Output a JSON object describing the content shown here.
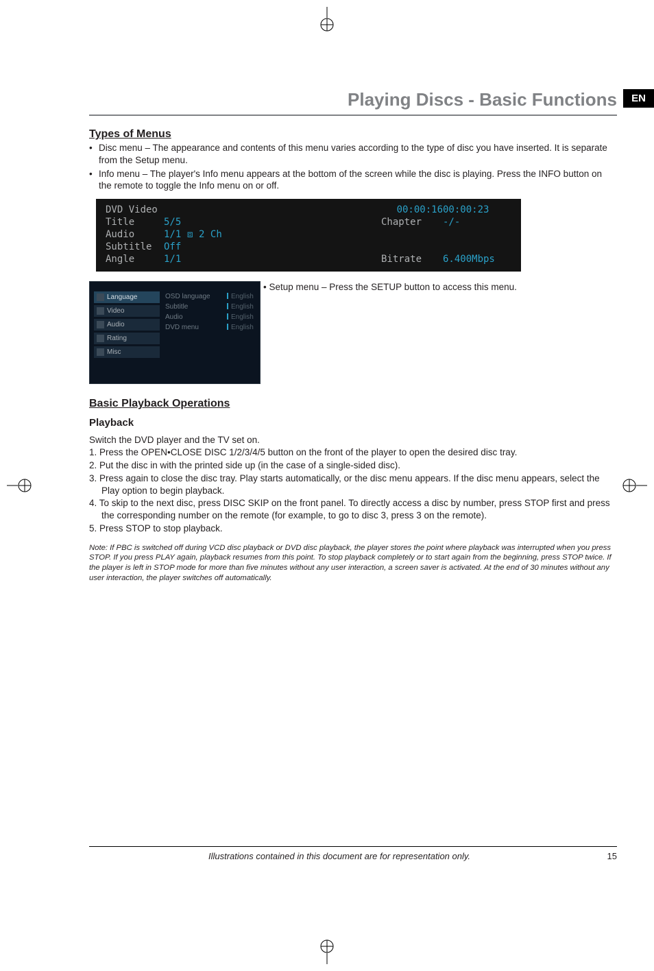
{
  "lang_tab": "EN",
  "section_title": "Playing Discs - Basic Functions",
  "types_heading": "Types of Menus",
  "types_bullets": [
    "Disc menu – The appearance and contents of this menu varies according to the type of disc you have inserted. It is separate from the Setup menu.",
    "Info menu – The player's Info menu appears at the bottom of the screen while the disc is playing. Press the INFO button on the remote to toggle the Info menu on or off."
  ],
  "info_panel": {
    "header_label": "DVD Video",
    "time_elapsed": "00:00:16",
    "time_total": "00:00:23",
    "title_label": "Title",
    "title_value": "5/5",
    "chapter_label": "Chapter",
    "chapter_value": "-/-",
    "audio_label": "Audio",
    "audio_value": "1/1 ⧈ 2 Ch",
    "subtitle_label": "Subtitle",
    "subtitle_value": "Off",
    "angle_label": "Angle",
    "angle_value": "1/1",
    "bitrate_label": "Bitrate",
    "bitrate_value": "6.400Mbps"
  },
  "setup_menu": {
    "tabs": [
      "Language",
      "Video",
      "Audio",
      "Rating",
      "Misc"
    ],
    "options": [
      "OSD language",
      "Subtitle",
      "Audio",
      "DVD menu"
    ],
    "values": [
      "English",
      "English",
      "English",
      "English"
    ]
  },
  "setup_caption": "Setup menu – Press the SETUP button to access this menu.",
  "basic_heading": "Basic Playback Operations",
  "playback_heading": "Playback",
  "playback_intro": "Switch the DVD player and the TV set on.",
  "playback_steps": [
    "1. Press the OPEN•CLOSE DISC 1/2/3/4/5 button on the front of the player to open the desired disc tray.",
    "2. Put the disc in with the printed side up (in the case of a single-sided disc).",
    "3. Press again to close the disc tray. Play starts automatically, or the disc menu appears. If the disc menu appears, select the Play option to begin playback.",
    "4. To skip to the next disc, press DISC SKIP on the front panel. To directly access a disc by number, press STOP first and press the corresponding number on the remote (for example, to go to disc 3, press 3 on the remote).",
    "5. Press STOP to stop playback."
  ],
  "note": "Note: If PBC is switched off during VCD disc playback or DVD disc playback, the player stores the point where playback was interrupted when you press STOP. If you press PLAY again, playback resumes from this point. To stop playback completely or to start again from the beginning, press STOP twice. If the player is left in STOP mode for more than five minutes without any user interaction, a screen saver is activated. At the end of 30 minutes without any user interaction, the player switches off automatically.",
  "footer_text": "Illustrations contained in this document are for representation only.",
  "page_number": "15"
}
